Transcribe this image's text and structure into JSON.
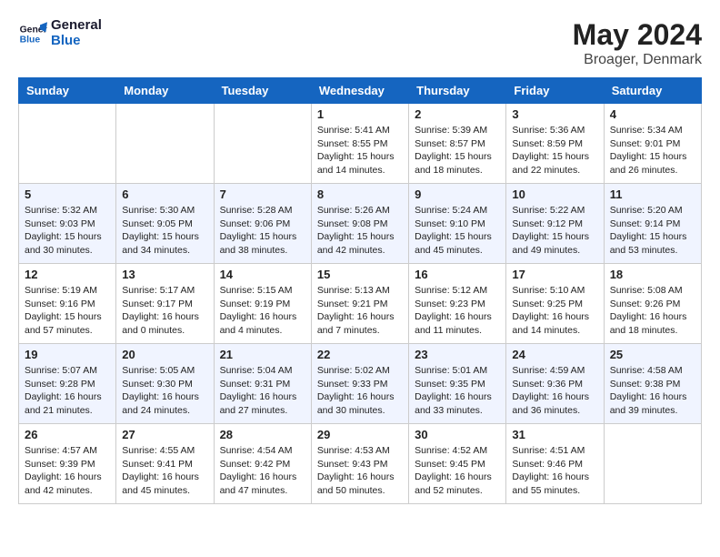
{
  "logo": {
    "name_part1": "General",
    "name_part2": "Blue"
  },
  "title": {
    "month_year": "May 2024",
    "location": "Broager, Denmark"
  },
  "weekdays": [
    "Sunday",
    "Monday",
    "Tuesday",
    "Wednesday",
    "Thursday",
    "Friday",
    "Saturday"
  ],
  "weeks": [
    [
      {
        "day": "",
        "text": ""
      },
      {
        "day": "",
        "text": ""
      },
      {
        "day": "",
        "text": ""
      },
      {
        "day": "1",
        "text": "Sunrise: 5:41 AM\nSunset: 8:55 PM\nDaylight: 15 hours\nand 14 minutes."
      },
      {
        "day": "2",
        "text": "Sunrise: 5:39 AM\nSunset: 8:57 PM\nDaylight: 15 hours\nand 18 minutes."
      },
      {
        "day": "3",
        "text": "Sunrise: 5:36 AM\nSunset: 8:59 PM\nDaylight: 15 hours\nand 22 minutes."
      },
      {
        "day": "4",
        "text": "Sunrise: 5:34 AM\nSunset: 9:01 PM\nDaylight: 15 hours\nand 26 minutes."
      }
    ],
    [
      {
        "day": "5",
        "text": "Sunrise: 5:32 AM\nSunset: 9:03 PM\nDaylight: 15 hours\nand 30 minutes."
      },
      {
        "day": "6",
        "text": "Sunrise: 5:30 AM\nSunset: 9:05 PM\nDaylight: 15 hours\nand 34 minutes."
      },
      {
        "day": "7",
        "text": "Sunrise: 5:28 AM\nSunset: 9:06 PM\nDaylight: 15 hours\nand 38 minutes."
      },
      {
        "day": "8",
        "text": "Sunrise: 5:26 AM\nSunset: 9:08 PM\nDaylight: 15 hours\nand 42 minutes."
      },
      {
        "day": "9",
        "text": "Sunrise: 5:24 AM\nSunset: 9:10 PM\nDaylight: 15 hours\nand 45 minutes."
      },
      {
        "day": "10",
        "text": "Sunrise: 5:22 AM\nSunset: 9:12 PM\nDaylight: 15 hours\nand 49 minutes."
      },
      {
        "day": "11",
        "text": "Sunrise: 5:20 AM\nSunset: 9:14 PM\nDaylight: 15 hours\nand 53 minutes."
      }
    ],
    [
      {
        "day": "12",
        "text": "Sunrise: 5:19 AM\nSunset: 9:16 PM\nDaylight: 15 hours\nand 57 minutes."
      },
      {
        "day": "13",
        "text": "Sunrise: 5:17 AM\nSunset: 9:17 PM\nDaylight: 16 hours\nand 0 minutes."
      },
      {
        "day": "14",
        "text": "Sunrise: 5:15 AM\nSunset: 9:19 PM\nDaylight: 16 hours\nand 4 minutes."
      },
      {
        "day": "15",
        "text": "Sunrise: 5:13 AM\nSunset: 9:21 PM\nDaylight: 16 hours\nand 7 minutes."
      },
      {
        "day": "16",
        "text": "Sunrise: 5:12 AM\nSunset: 9:23 PM\nDaylight: 16 hours\nand 11 minutes."
      },
      {
        "day": "17",
        "text": "Sunrise: 5:10 AM\nSunset: 9:25 PM\nDaylight: 16 hours\nand 14 minutes."
      },
      {
        "day": "18",
        "text": "Sunrise: 5:08 AM\nSunset: 9:26 PM\nDaylight: 16 hours\nand 18 minutes."
      }
    ],
    [
      {
        "day": "19",
        "text": "Sunrise: 5:07 AM\nSunset: 9:28 PM\nDaylight: 16 hours\nand 21 minutes."
      },
      {
        "day": "20",
        "text": "Sunrise: 5:05 AM\nSunset: 9:30 PM\nDaylight: 16 hours\nand 24 minutes."
      },
      {
        "day": "21",
        "text": "Sunrise: 5:04 AM\nSunset: 9:31 PM\nDaylight: 16 hours\nand 27 minutes."
      },
      {
        "day": "22",
        "text": "Sunrise: 5:02 AM\nSunset: 9:33 PM\nDaylight: 16 hours\nand 30 minutes."
      },
      {
        "day": "23",
        "text": "Sunrise: 5:01 AM\nSunset: 9:35 PM\nDaylight: 16 hours\nand 33 minutes."
      },
      {
        "day": "24",
        "text": "Sunrise: 4:59 AM\nSunset: 9:36 PM\nDaylight: 16 hours\nand 36 minutes."
      },
      {
        "day": "25",
        "text": "Sunrise: 4:58 AM\nSunset: 9:38 PM\nDaylight: 16 hours\nand 39 minutes."
      }
    ],
    [
      {
        "day": "26",
        "text": "Sunrise: 4:57 AM\nSunset: 9:39 PM\nDaylight: 16 hours\nand 42 minutes."
      },
      {
        "day": "27",
        "text": "Sunrise: 4:55 AM\nSunset: 9:41 PM\nDaylight: 16 hours\nand 45 minutes."
      },
      {
        "day": "28",
        "text": "Sunrise: 4:54 AM\nSunset: 9:42 PM\nDaylight: 16 hours\nand 47 minutes."
      },
      {
        "day": "29",
        "text": "Sunrise: 4:53 AM\nSunset: 9:43 PM\nDaylight: 16 hours\nand 50 minutes."
      },
      {
        "day": "30",
        "text": "Sunrise: 4:52 AM\nSunset: 9:45 PM\nDaylight: 16 hours\nand 52 minutes."
      },
      {
        "day": "31",
        "text": "Sunrise: 4:51 AM\nSunset: 9:46 PM\nDaylight: 16 hours\nand 55 minutes."
      },
      {
        "day": "",
        "text": ""
      }
    ]
  ]
}
